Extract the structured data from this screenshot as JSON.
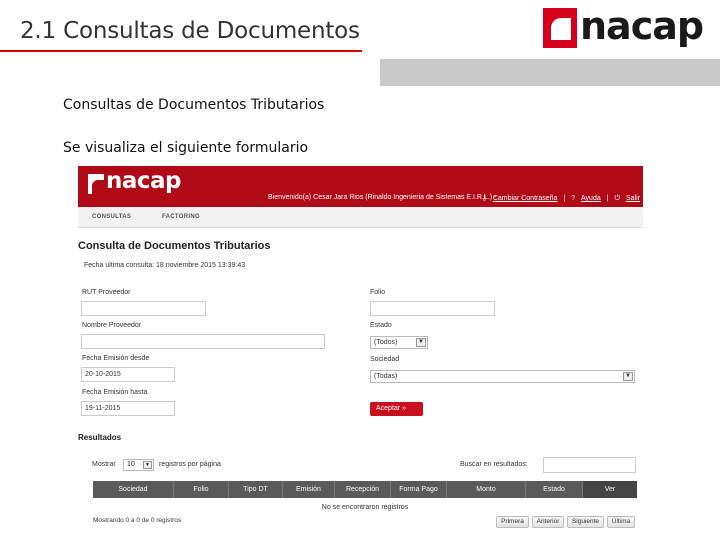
{
  "slide": {
    "title": "2.1 Consultas de Documentos",
    "logo_text": "nacap",
    "subtitle": "Consultas de Documentos  Tributarios",
    "text": "Se visualiza el siguiente formulario",
    "accent_color": "#e00000"
  },
  "app": {
    "logo_text": "nacap",
    "brand_color": "#b00a16",
    "welcome": "Bienvenido(a) Cesar Jara Rios (Rinaldo Ingenieria de Sistemas E.I.R.L.) -",
    "links": {
      "change_password": "Cambiar Contraseña",
      "separator1": "|",
      "help": "Ayuda",
      "separator2": "|",
      "logout": "Salir"
    },
    "nav": [
      "CONSULTAS",
      "FACTORING"
    ],
    "form": {
      "title": "Consulta de Documentos Tributarios",
      "last_query": "Fecha ultima consulta: 18 noviembre 2015 13:39:43",
      "rut_label": "RUT Proveedor",
      "rut_value": "",
      "provider_label": "Nombre Proveedor",
      "provider_value": "",
      "date_from_label": "Fecha Emisión desde",
      "date_from_value": "20-10-2015",
      "date_to_label": "Fecha Emisión hasta",
      "date_to_value": "19-11-2015",
      "folio_label": "Folio",
      "folio_value": "",
      "state_label": "Estado",
      "state_value": "(Todos)",
      "society_label": "Sociedad",
      "society_value": "(Todas)",
      "accept_button": "Aceptar »"
    },
    "results": {
      "title": "Resultados",
      "show_label": "Mostrar",
      "show_value": "10",
      "per_page_label": "registros por página",
      "search_label": "Buscar en resultados:",
      "search_value": "",
      "columns": [
        "Sociedad",
        "Folio",
        "Tipo DT",
        "Emisión",
        "Recepción",
        "Forma Pago",
        "Monto",
        "Estado",
        "Ver"
      ],
      "empty_message": "No se encontraron registros",
      "showing": "Mostrando 0 a 0 de 0 registros",
      "pager": [
        "Primera",
        "Anterior",
        "Siguiente",
        "Última"
      ]
    }
  }
}
